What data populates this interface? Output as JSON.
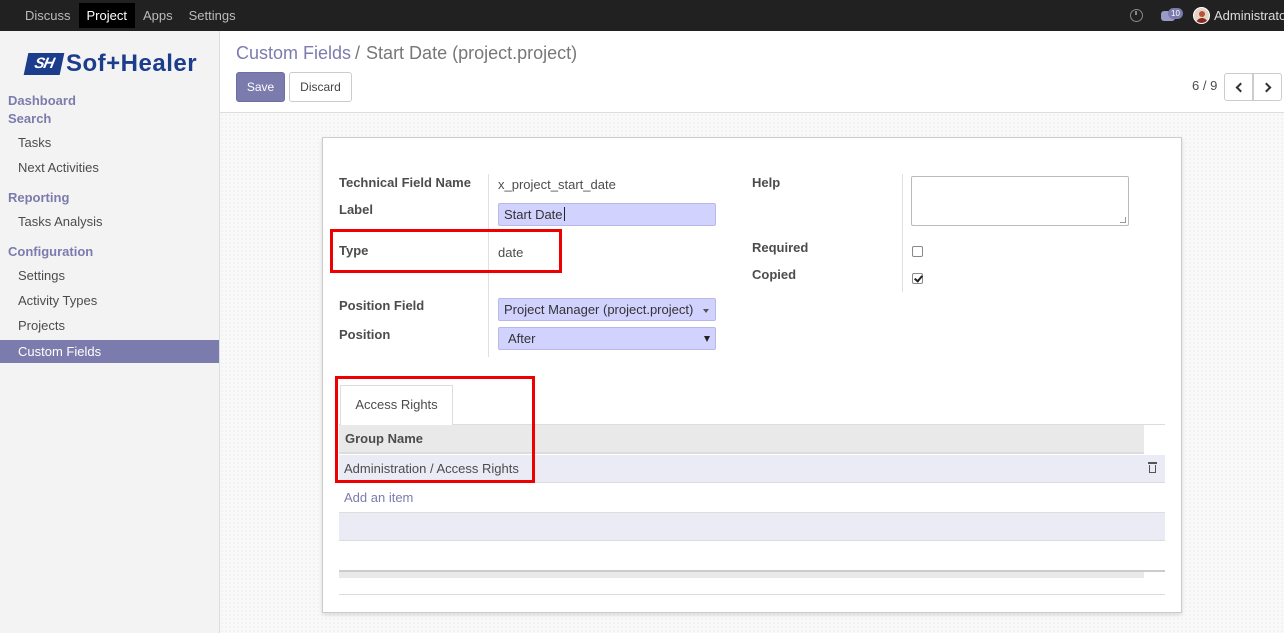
{
  "topbar": {
    "menu": [
      "Discuss",
      "Project",
      "Apps",
      "Settings"
    ],
    "active_menu": "Project",
    "chat_count": "10",
    "user": "Administrator"
  },
  "sidebar": {
    "logo_mark": "SH",
    "logo_text": "Sof+Healer",
    "dashboard": "Dashboard",
    "search": "Search",
    "tasks": "Tasks",
    "next_activities": "Next Activities",
    "reporting": "Reporting",
    "tasks_analysis": "Tasks Analysis",
    "configuration": "Configuration",
    "settings": "Settings",
    "activity_types": "Activity Types",
    "projects": "Projects",
    "custom_fields": "Custom Fields",
    "active_item": "Custom Fields"
  },
  "breadcrumb": {
    "parent": "Custom Fields",
    "separator": "/",
    "current": "Start Date (project.project)"
  },
  "buttons": {
    "save": "Save",
    "discard": "Discard"
  },
  "pager": {
    "value": "6 / 9"
  },
  "form": {
    "technical_field_name_label": "Technical Field Name",
    "technical_field_name": "x_project_start_date",
    "label_label": "Label",
    "label_value": "Start Date",
    "type_label": "Type",
    "type_value": "date",
    "position_field_label": "Position Field",
    "position_field_value": "Project Manager (project.project)",
    "position_label": "Position",
    "position_value": "After",
    "help_label": "Help",
    "help_value": "",
    "required_label": "Required",
    "required": false,
    "copied_label": "Copied",
    "copied": true
  },
  "tabs": {
    "access_rights": "Access Rights"
  },
  "access_table": {
    "header": "Group Name",
    "rows": [
      "Administration / Access Rights"
    ],
    "add_item": "Add an item"
  },
  "colors": {
    "accent": "#7c7bad",
    "topbar": "#212121",
    "highlight_box": "#e00000",
    "input_bg": "#d2d2ff"
  }
}
